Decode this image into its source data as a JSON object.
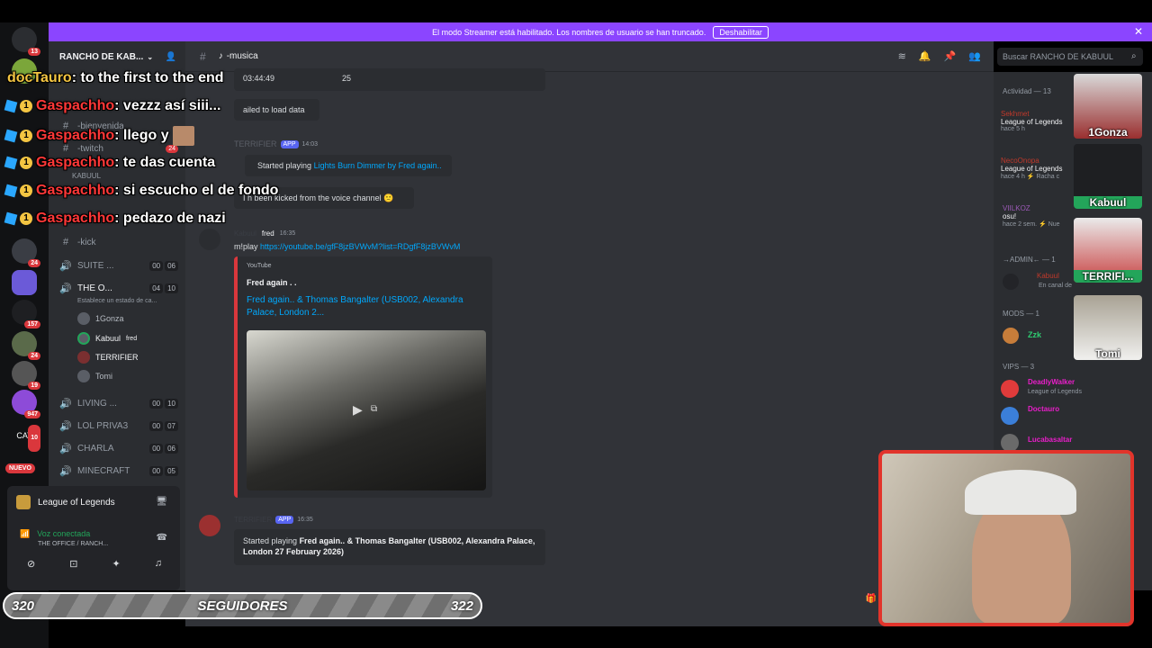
{
  "banner": {
    "text": "El modo Streamer está habilitado. Los nombres de usuario se han truncado.",
    "button": "Deshabilitar",
    "close": "✕"
  },
  "servers": {
    "badges": [
      "13",
      "24",
      "157",
      "24",
      "19",
      "947",
      "10"
    ],
    "cat_label": "CAT",
    "new_label": "NUEVO"
  },
  "server": {
    "name": "RANCHO DE KAB..."
  },
  "channels": {
    "text": [
      "-bienvenida",
      "-twitch",
      "-kick"
    ],
    "twitch_badge": "24",
    "kabuul_line": "KABUUL",
    "voice": [
      {
        "name": "SUITE ...",
        "a": "00",
        "b": "06"
      },
      {
        "name": "THE O...",
        "a": "04",
        "b": "10"
      },
      {
        "name": "LIVING ...",
        "a": "00",
        "b": "10"
      },
      {
        "name": "LOL PRIVA3",
        "a": "00",
        "b": "07"
      },
      {
        "name": "CHARLA",
        "a": "00",
        "b": "06"
      },
      {
        "name": "MINECRAFT",
        "a": "00",
        "b": "05"
      }
    ],
    "status_hint": "Establece un estado de ca...",
    "voice_users": [
      "1Gonza",
      "Kabuul",
      "TERRIFIER",
      "Tomi"
    ],
    "kabuul_tag": "fred"
  },
  "userpanel": {
    "game": "League of Legends",
    "voice": "Voz conectada",
    "channel": "THE OFFICE / RANCH..."
  },
  "header": {
    "channel": "-musica",
    "search": "Buscar RANCHO DE KABUUL"
  },
  "messages": {
    "time_row": {
      "time": "03:44:49",
      "count": "25"
    },
    "failed": "ailed to load data",
    "bot_name": "TERRIFIER",
    "app": "APP",
    "time1": "14:03",
    "started": "Started playing",
    "track1": "Lights Burn Dimmer by Fred again..",
    "kicked": "I h   been kicked from the voice channel 🙁",
    "user2": "Kabuul",
    "tag2": "fred",
    "time2": "16:35",
    "cmd": "m!play",
    "url": "https://youtube.be/gfF8jzBVWvM?list=RDgfF8jzBVWvM",
    "embed": {
      "provider": "YouTube",
      "author": "Fred again . .",
      "title": "Fred again.. & Thomas Bangalter (USB002, Alexandra Palace, London 2..."
    },
    "time3": "16:35",
    "started2": "Started playing",
    "track2": "Fred again.. & Thomas Bangalter (USB002, Alexandra Palace, London 27 February 2026)"
  },
  "members": {
    "activity": "Actividad — 13",
    "rows": [
      {
        "name": "Sekhmet",
        "line1": "League of Legends",
        "line2": "hace 5 h"
      },
      {
        "name": "NecoOnopa",
        "line1": "League of Legends",
        "line2": "hace 4 h  ⚡ Racha c"
      },
      {
        "name": "VIILKOZ",
        "line1": "osu!",
        "line2": "hace 2 sem.  ⚡ Nue"
      }
    ],
    "admin": "→ADMIN← — 1",
    "admin_user": "Kabuul",
    "admin_sub": "En canal de",
    "mods": "MODS — 1",
    "mod_user": "Zzk",
    "vips": "VIPS — 3",
    "vip_users": [
      {
        "name": "DeadlyWalker",
        "sub": "League of Legends"
      },
      {
        "name": "Doctauro",
        "sub": ""
      },
      {
        "name": "Lucabasaltar",
        "sub": ""
      }
    ]
  },
  "overlay_chat": [
    {
      "name": "docTauro",
      "text": ": to the first to the end"
    },
    {
      "name": "Gaspachho",
      "text": ": vezzz así siii..."
    },
    {
      "name": "Gaspachho",
      "text": ": llego y"
    },
    {
      "name": "Gaspachho",
      "text": ": te das cuenta"
    },
    {
      "name": "Gaspachho",
      "text": ": si escucho el     de fondo"
    },
    {
      "name": "Gaspachho",
      "text": ": pedazo de nazi"
    }
  ],
  "cams": [
    "1Gonza",
    "Kabuul",
    "TERRIFI...",
    "Tomi"
  ],
  "followers": {
    "current": "320",
    "label": "SEGUIDORES",
    "goal": "322"
  }
}
